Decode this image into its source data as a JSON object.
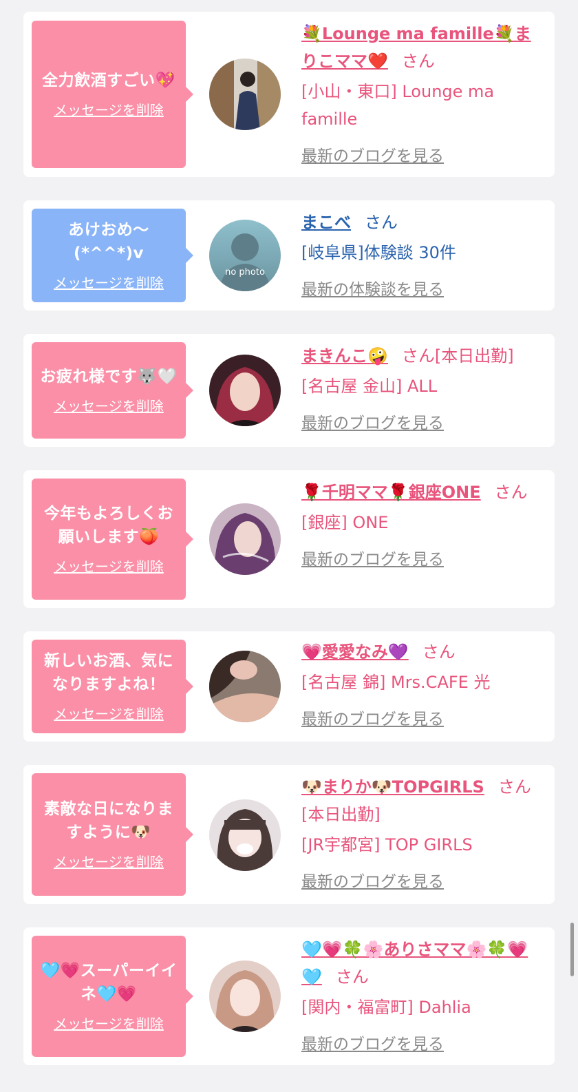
{
  "cards": [
    {
      "bubble_color": "#fb8fa7",
      "bubble_text": "全力飲酒すごい💖",
      "delete_label": "メッセージを削除",
      "name": "💐Lounge ma famille💐まりこママ❤️",
      "san": "さん",
      "status": "",
      "shop": "[小山・東口] Lounge ma famille",
      "more_label": "最新のブログを見る",
      "avatar_icon": "photo-avatar"
    },
    {
      "bubble_color": "#8ab4f8",
      "bubble_text": "あけおめ〜(*^^*)v",
      "delete_label": "メッセージを削除",
      "name": "まこべ",
      "san": "さん",
      "status": "",
      "shop": "[岐阜県]体験談 30件",
      "more_label": "最新の体験談を見る",
      "avatar_icon": "no-photo-avatar",
      "no_photo_text": "no photo"
    },
    {
      "bubble_color": "#fb8fa7",
      "bubble_text": "お疲れ様です🐺🤍",
      "delete_label": "メッセージを削除",
      "name": "まきんこ🤪",
      "san": "さん",
      "status": "[本日出勤]",
      "shop": "[名古屋 金山] ALL",
      "more_label": "最新のブログを見る",
      "avatar_icon": "photo-avatar"
    },
    {
      "bubble_color": "#fb8fa7",
      "bubble_text": "今年もよろしくお願いします🍑",
      "delete_label": "メッセージを削除",
      "name": "🌹千明ママ🌹銀座ONE",
      "san": "さん",
      "status": "",
      "shop": "[銀座] ONE",
      "more_label": "最新のブログを見る",
      "avatar_icon": "photo-avatar"
    },
    {
      "bubble_color": "#fb8fa7",
      "bubble_text": "新しいお酒、気になりますよね！",
      "delete_label": "メッセージを削除",
      "name": "💗愛愛なみ💜",
      "san": "さん",
      "status": "",
      "shop": "[名古屋 錦] Mrs.CAFE 光",
      "more_label": "最新のブログを見る",
      "avatar_icon": "photo-avatar"
    },
    {
      "bubble_color": "#fb8fa7",
      "bubble_text": "素敵な日になりますように🐶",
      "delete_label": "メッセージを削除",
      "name": "🐶まりか🐶TOPGIRLS",
      "san": "さん",
      "status": "[本日出勤]",
      "shop": "[JR宇都宮] TOP GIRLS",
      "more_label": "最新のブログを見る",
      "avatar_icon": "photo-avatar"
    },
    {
      "bubble_color": "#fb8fa7",
      "bubble_text": "🩵💗スーパーイイネ🩵💗",
      "delete_label": "メッセージを削除",
      "name": "🩵💗🍀🌸ありさママ🌸🍀💗🩵",
      "san": "さん",
      "status": "",
      "shop": "[関内・福富町] Dahlia",
      "more_label": "最新のブログを見る",
      "avatar_icon": "photo-avatar"
    }
  ]
}
